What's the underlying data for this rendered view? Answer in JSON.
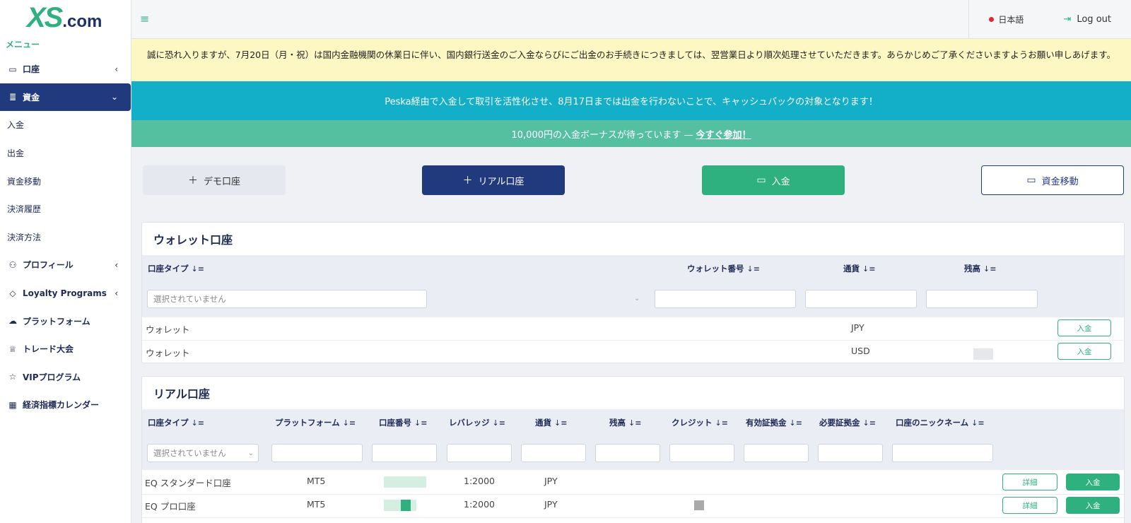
{
  "brand": {
    "logo_main": "XS",
    "logo_suffix": ".com",
    "accent": "#2fb07f",
    "navy": "#213a7e"
  },
  "sidebar": {
    "menu_label": "メニュー",
    "items": [
      {
        "label": "口座",
        "icon": "wallet-icon",
        "expandable": true
      },
      {
        "label": "資金",
        "icon": "coins-icon",
        "expandable": true,
        "active": true
      },
      {
        "label": "プロフィール",
        "icon": "user-icon",
        "expandable": true
      },
      {
        "label": "Loyalty Programs",
        "icon": "diamond-icon",
        "expandable": true
      },
      {
        "label": "プラットフォーム",
        "icon": "cloud-download-icon"
      },
      {
        "label": "トレード大会",
        "icon": "trophy-icon"
      },
      {
        "label": "VIPプログラム",
        "icon": "star-icon"
      },
      {
        "label": "経済指標カレンダー",
        "icon": "calendar-icon"
      }
    ],
    "subitems": [
      "入金",
      "出金",
      "資金移動",
      "決済履歴",
      "決済方法"
    ]
  },
  "topbar": {
    "language": "日本語",
    "logout": "Log out"
  },
  "banners": {
    "notice": "誠に恐れ入りますが、7月20日（月・祝）は国内金融機関の休業日に伴い、国内銀行送金のご入金ならびにご出金のお手続きにつきましては、翌営業日より順次処理させていただきます。あらかじめご了承くださいますようお願い申しあげます。",
    "cashback": "Peska経由で入金して取引を活性化させ、8月17日までは出金を行わないことで、キャッシュバックの対象となります！",
    "bonus": "10,000円の入金ボーナスが待っています —",
    "bonus_cta": "今すぐ参加！"
  },
  "actions": {
    "demo": "デモ口座",
    "real": "リアル口座",
    "deposit": "入金",
    "transfer": "資金移動"
  },
  "wallet": {
    "title": "ウォレット口座",
    "columns": [
      "口座タイプ",
      "ウォレット番号",
      "通貨",
      "残高"
    ],
    "filter_placeholder": "選択されていません",
    "rows": [
      {
        "type": "ウォレット",
        "currency": "JPY",
        "action": "入金"
      },
      {
        "type": "ウォレット",
        "currency": "USD",
        "action": "入金"
      }
    ]
  },
  "real": {
    "title": "リアル口座",
    "columns": [
      "口座タイプ",
      "プラットフォーム",
      "口座番号",
      "レバレッジ",
      "通貨",
      "残高",
      "クレジット",
      "有効証拠金",
      "必要証拠金",
      "口座のニックネーム"
    ],
    "filter_placeholder": "選択されていません",
    "rows": [
      {
        "type": "EQ スタンダード口座",
        "platform": "MT5",
        "leverage": "1:2000",
        "currency": "JPY",
        "detail": "詳細",
        "deposit": "入金"
      },
      {
        "type": "EQ プロ口座",
        "platform": "MT5",
        "leverage": "1:2000",
        "currency": "JPY",
        "detail": "詳細",
        "deposit": "入金"
      }
    ]
  }
}
